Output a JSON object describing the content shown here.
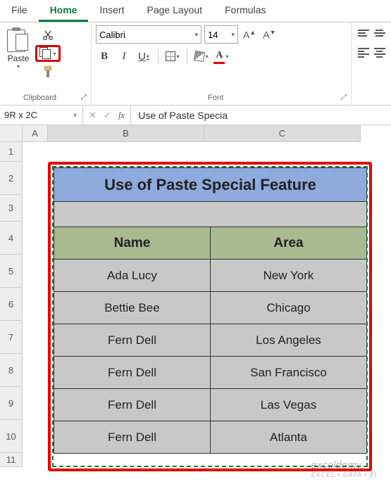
{
  "menubar": {
    "file": "File",
    "home": "Home",
    "insert": "Insert",
    "page_layout": "Page Layout",
    "formulas": "Formulas"
  },
  "ribbon": {
    "clipboard": {
      "paste": "Paste",
      "group_label": "Clipboard"
    },
    "font": {
      "family": "Calibri",
      "size": "14",
      "bold": "B",
      "italic": "I",
      "underline": "U",
      "font_color_letter": "A",
      "grow": "A˄",
      "shrink": "A˅",
      "group_label": "Font"
    }
  },
  "namebox": "9R x 2C",
  "formula": "Use of Paste Specia",
  "columns": {
    "a": "A",
    "b": "B",
    "c": "C"
  },
  "rows": [
    "1",
    "2",
    "3",
    "4",
    "5",
    "6",
    "7",
    "8",
    "9",
    "10",
    "11"
  ],
  "table": {
    "title": "Use of Paste Special Feature",
    "headers": {
      "name": "Name",
      "area": "Area"
    },
    "data": [
      {
        "name": "Ada Lucy",
        "area": "New York"
      },
      {
        "name": "Bettie Bee",
        "area": "Chicago"
      },
      {
        "name": "Fern Dell",
        "area": "Los Angeles"
      },
      {
        "name": "Fern Dell",
        "area": "San Francisco"
      },
      {
        "name": "Fern Dell",
        "area": "Las Vegas"
      },
      {
        "name": "Fern Dell",
        "area": "Atlanta"
      }
    ]
  },
  "watermark": {
    "main": "exceldemy",
    "sub": "EXCEL • DATA • BI"
  }
}
